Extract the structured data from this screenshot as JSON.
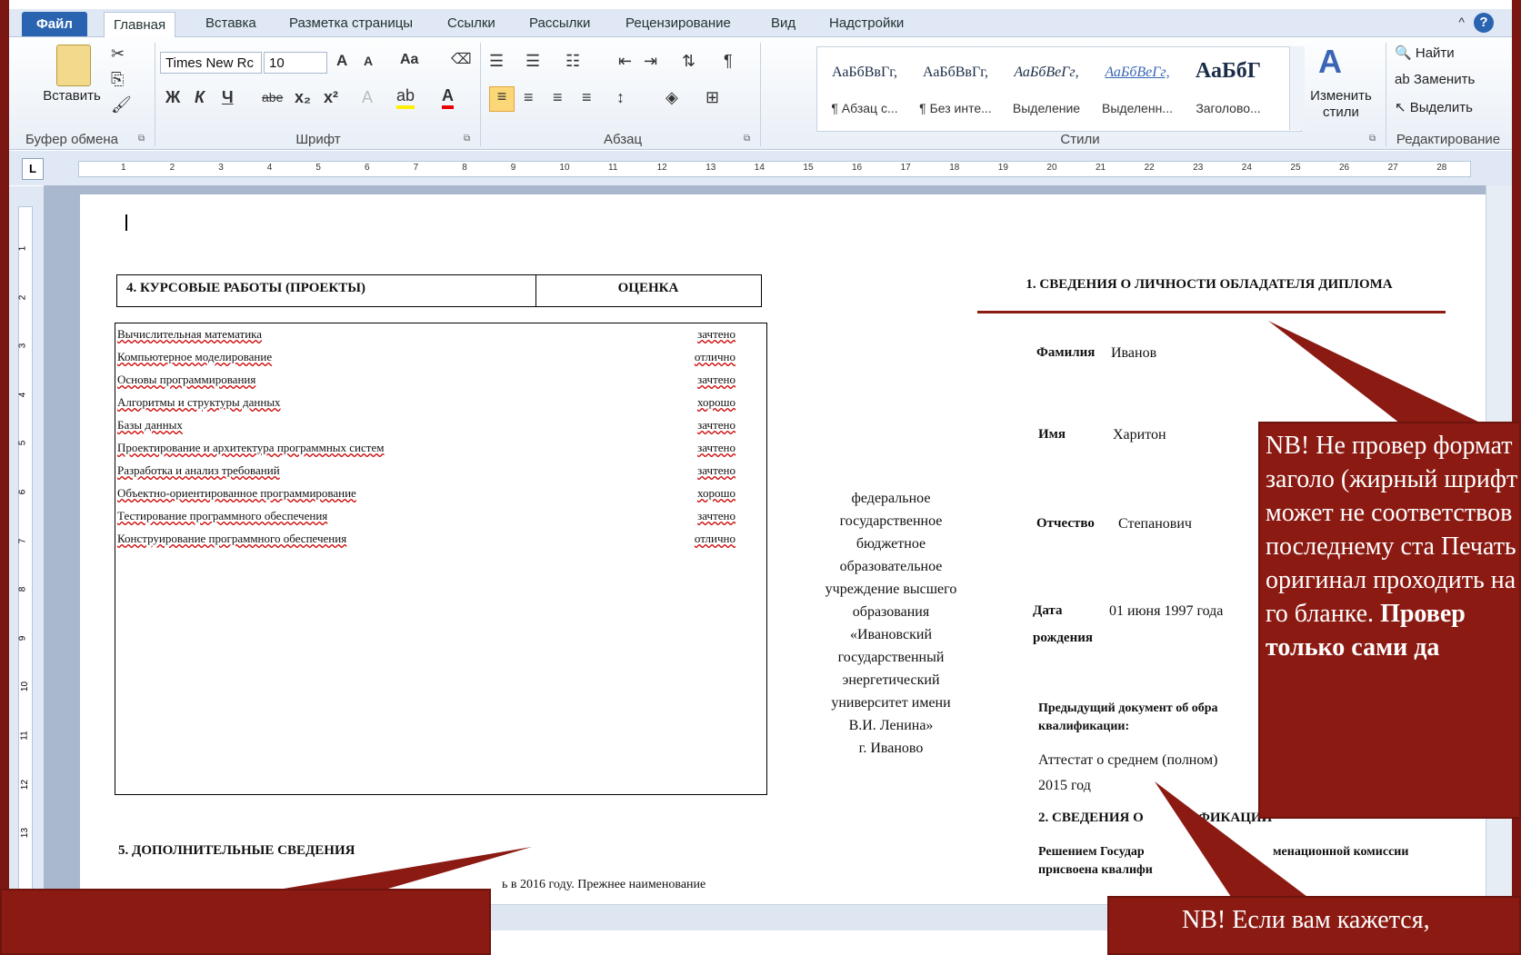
{
  "ribbon": {
    "tabs": [
      "Файл",
      "Главная",
      "Вставка",
      "Разметка страницы",
      "Ссылки",
      "Рассылки",
      "Рецензирование",
      "Вид",
      "Надстройки"
    ],
    "clipboard": {
      "paste": "Вставить",
      "group": "Буфер обмена"
    },
    "font": {
      "name": "Times New Rc",
      "size": "10",
      "group": "Шрифт",
      "aa": "Aa",
      "bold": "Ж",
      "italic": "К",
      "underline": "Ч",
      "strike": "abe"
    },
    "paragraph": {
      "group": "Абзац"
    },
    "styles": {
      "group": "Стили",
      "change": "Изменить стили",
      "items": [
        {
          "sample": "АаБбВвГг,",
          "name": "¶ Абзац с..."
        },
        {
          "sample": "АаБбВвГг,",
          "name": "¶ Без инте..."
        },
        {
          "sample": "АаБбВеГг,",
          "name": "Выделение"
        },
        {
          "sample": "АаБбВеГг,",
          "name": "Выделенн..."
        },
        {
          "sample": "АаБбГ",
          "name": "Заголово..."
        }
      ]
    },
    "editing": {
      "find": "Найти",
      "replace": "Заменить",
      "select": "Выделить",
      "group": "Редактирование"
    }
  },
  "ruler_numbers": [
    "1",
    "2",
    "3",
    "4",
    "5",
    "6",
    "7",
    "8",
    "9",
    "10",
    "11",
    "12",
    "13",
    "14",
    "15",
    "16",
    "17",
    "18",
    "19",
    "20",
    "21",
    "22",
    "23",
    "24",
    "25",
    "26",
    "27",
    "28"
  ],
  "vruler_numbers": [
    "1",
    "2",
    "3",
    "4",
    "5",
    "6",
    "7",
    "8",
    "9",
    "10",
    "11",
    "12",
    "13"
  ],
  "document": {
    "courses_header": "4. КУРСОВЫЕ РАБОТЫ (ПРОЕКТЫ)",
    "grade_header": "ОЦЕНКА",
    "courses": [
      {
        "name": "Вычислительная математика",
        "grade": "зачтено"
      },
      {
        "name": "Компьютерное моделирование",
        "grade": "отлично"
      },
      {
        "name": "Основы программирования",
        "grade": "зачтено"
      },
      {
        "name": "Алгоритмы и структуры данных",
        "grade": "хорошо"
      },
      {
        "name": "Базы данных",
        "grade": "зачтено"
      },
      {
        "name": "Проектирование и архитектура программных систем",
        "grade": "зачтено"
      },
      {
        "name": "Разработка и анализ требований",
        "grade": "зачтено"
      },
      {
        "name": "Объектно-ориентированное программирование",
        "grade": "хорошо"
      },
      {
        "name": "Тестирование программного обеспечения",
        "grade": "зачтено"
      },
      {
        "name": "Конструирование программного обеспечения",
        "grade": "отлично"
      }
    ],
    "section5": "5. ДОПОЛНИТЕЛЬНЫЕ  СВЕДЕНИЯ",
    "section5_text": "ь в 2016 году. Прежнее наименование",
    "university": [
      "федеральное",
      "государственное",
      "бюджетное",
      "образовательное",
      "учреждение высшего",
      "образования",
      "«Ивановский",
      "государственный",
      "энергетический",
      "университет имени",
      "В.И. Ленина»",
      "г. Иваново"
    ],
    "section1": "1. СВЕДЕНИЯ О ЛИЧНОСТИ ОБЛАДАТЕЛЯ ДИПЛОМА",
    "surname_label": "Фамилия",
    "surname": "Иванов",
    "name_label": "Имя",
    "name": "Харитон",
    "patronymic_label": "Отчество",
    "patronymic": "Степанович",
    "dob_label": "Дата",
    "dob_label2": "рождения",
    "dob": "01 июня 1997 года",
    "prev_doc_label": "Предыдущий документ об обра",
    "prev_doc_label2": "квалификации:",
    "prev_doc": "Аттестат о среднем (полном)",
    "prev_doc_year": "2015 год",
    "section2": "2. СВЕДЕНИЯ О",
    "section2_tail": "ФИКАЦИИ",
    "decision": "Решением Государ",
    "decision_tail": "менационной комиссии",
    "assigned": "присвоена квалифи"
  },
  "callouts": {
    "right_text": "NB! Не провер формат заголо (жирный шрифт может не соответствов последнему ста Печать оригинал проходить на го бланке.",
    "right_bold": "Провер только сами да",
    "bottom_text": "NB! Если вам кажется,"
  },
  "colors": {
    "accent": "#8b1a12",
    "ribbon": "#dfe8f4",
    "file_tab": "#2a64b1"
  }
}
